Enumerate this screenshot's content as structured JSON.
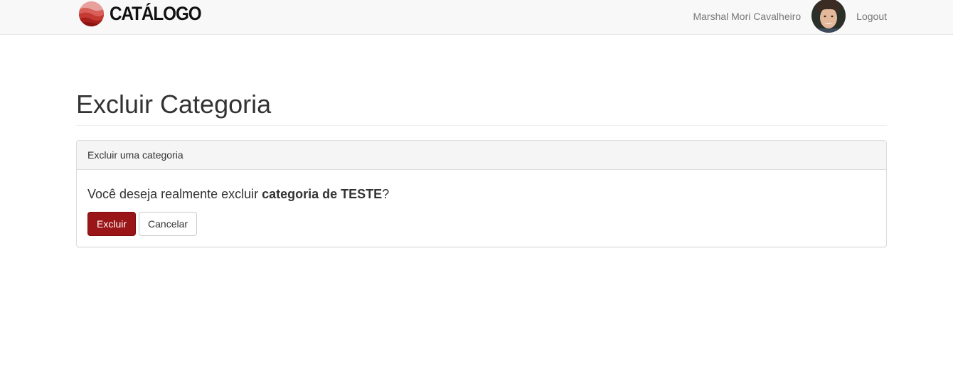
{
  "navbar": {
    "brand_text": "CATÁLOGO",
    "user_name": "Marshal Mori Cavalheiro",
    "logout_label": "Logout"
  },
  "page": {
    "title": "Excluir Categoria"
  },
  "panel": {
    "heading": "Excluir uma categoria",
    "question_prefix": "Você deseja realmente excluir ",
    "category_name": "categoria de TESTE",
    "question_suffix": "?",
    "delete_label": "Excluir",
    "cancel_label": "Cancelar"
  },
  "colors": {
    "danger": "#9a1518",
    "navbar_bg": "#f8f8f8",
    "logo_red": "#c0392b"
  },
  "icons": {
    "logo": "catalogo-logo-icon",
    "avatar": "user-avatar"
  }
}
